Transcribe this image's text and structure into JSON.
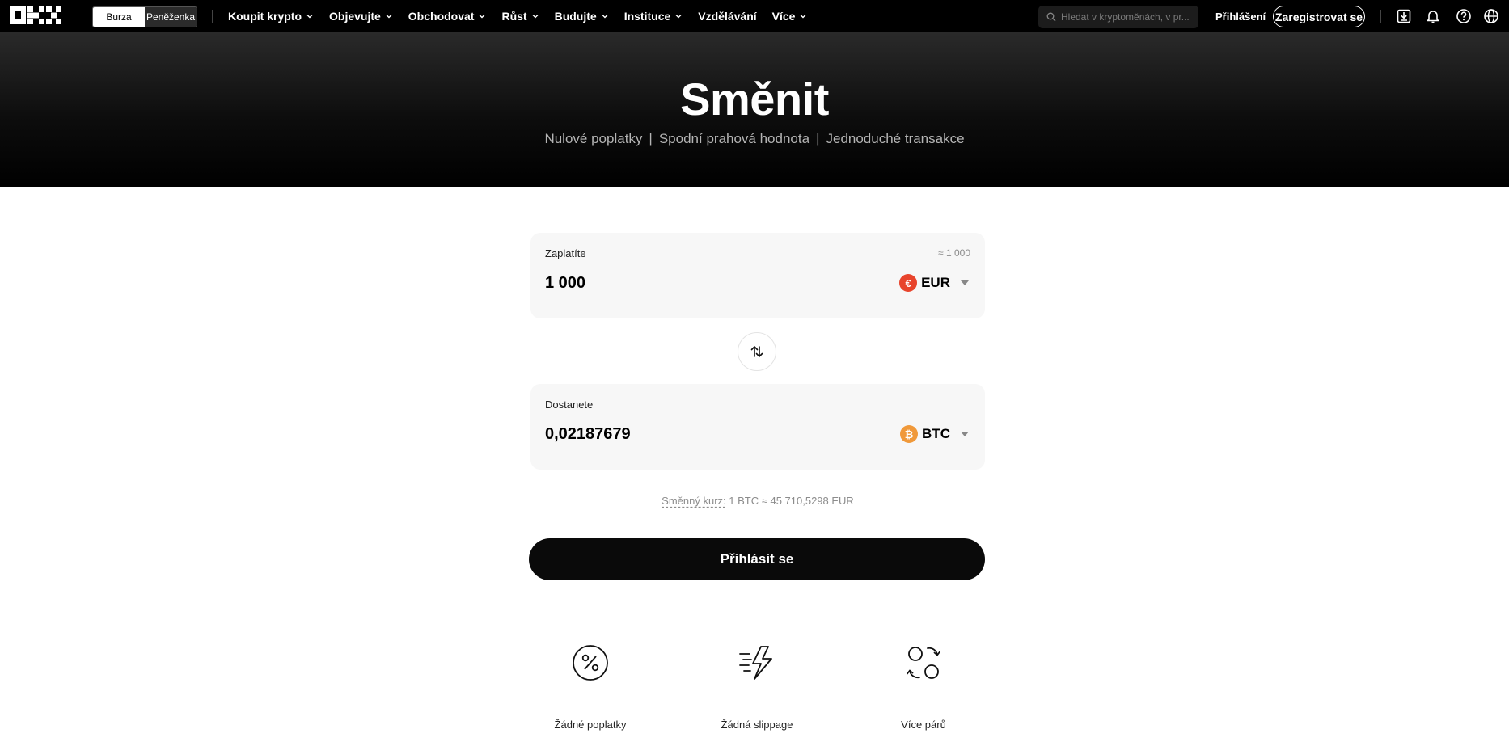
{
  "nav": {
    "logo_alt": "OKX",
    "mode_switch": [
      "Burza",
      "Peněženka"
    ],
    "menu": [
      {
        "label": "Koupit krypto",
        "has_dropdown": true
      },
      {
        "label": "Objevujte",
        "has_dropdown": true
      },
      {
        "label": "Obchodovat",
        "has_dropdown": true
      },
      {
        "label": "Růst",
        "has_dropdown": true
      },
      {
        "label": "Budujte",
        "has_dropdown": true
      },
      {
        "label": "Instituce",
        "has_dropdown": true
      },
      {
        "label": "Vzdělávání",
        "has_dropdown": false
      },
      {
        "label": "Více",
        "has_dropdown": true
      }
    ],
    "search_placeholder": "Hledat v kryptoměnách, v pr...",
    "login": "Přihlášení",
    "signup": "Zaregistrovat se",
    "icons": [
      "download-icon",
      "bell-icon",
      "help-icon",
      "globe-icon"
    ]
  },
  "hero": {
    "title": "Směnit",
    "features": [
      "Nulové poplatky",
      "Spodní prahová hodnota",
      "Jednoduché transakce"
    ],
    "separator": "|"
  },
  "convert": {
    "pay": {
      "label": "Zaplatíte",
      "approx": "≈ 1 000",
      "amount": "1 000",
      "currency": "EUR",
      "coin_symbol": "€",
      "coin_color": "#e8442c"
    },
    "receive": {
      "label": "Dostanete",
      "amount": "0,02187679",
      "currency": "BTC",
      "coin_symbol": "₿",
      "coin_color": "#f0993a"
    },
    "rate_label": "Směnný kurz:",
    "rate_value": "1 BTC ≈ 45 710,5298 EUR",
    "submit": "Přihlásit se"
  },
  "features": [
    {
      "label": "Žádné poplatky",
      "icon": "percent-icon"
    },
    {
      "label": "Žádná slippage",
      "icon": "lightning-icon"
    },
    {
      "label": "Více párů",
      "icon": "pairs-icon"
    }
  ],
  "colors": {
    "nav_bg": "#000000",
    "card_bg": "#f7f7f7",
    "button_bg": "#0a0a0a"
  }
}
